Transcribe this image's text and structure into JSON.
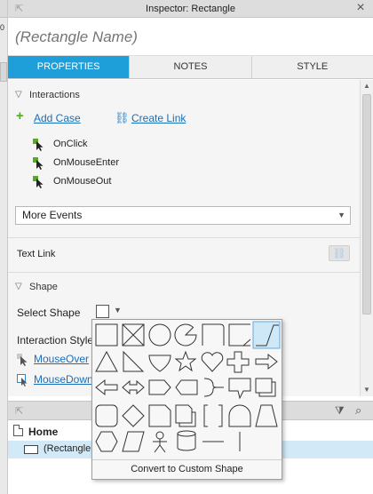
{
  "left_window": {
    "fragment_text": "0"
  },
  "titlebar": {
    "title": "Inspector: Rectangle"
  },
  "name_field": {
    "placeholder": "(Rectangle Name)",
    "value": ""
  },
  "tabs": [
    {
      "label": "PROPERTIES",
      "active": true
    },
    {
      "label": "NOTES",
      "active": false
    },
    {
      "label": "STYLE",
      "active": false
    }
  ],
  "interactions": {
    "heading": "Interactions",
    "add_case": "Add Case",
    "create_link": "Create Link",
    "events": [
      "OnClick",
      "OnMouseEnter",
      "OnMouseOut"
    ],
    "more_events": "More Events"
  },
  "text_link": {
    "label": "Text Link"
  },
  "shape": {
    "heading": "Shape",
    "select_shape_label": "Select Shape",
    "interaction_styles_label": "Interaction Style",
    "style_links": [
      "MouseOver",
      "MouseDown"
    ]
  },
  "shape_picker": {
    "convert_label": "Convert to Custom Shape",
    "shapes": [
      "rectangle",
      "placeholder",
      "ellipse",
      "pie",
      "corner-rectangle",
      "tab-rectangle",
      "snip-corner",
      "triangle",
      "right-triangle",
      "drop",
      "star",
      "heart",
      "plus",
      "right-arrow",
      "left-arrow",
      "double-arrow",
      "pentagon",
      "hexagon-tag",
      "brace",
      "callout",
      "stacked-pages",
      "rounded-rectangle",
      "diamond",
      "document",
      "multi-document",
      "bracket",
      "arch",
      "trapezoid",
      "hexagon",
      "parallelogram",
      "actor",
      "database",
      "horizontal-line",
      "vertical-line"
    ],
    "selected_index": 6
  },
  "outline": {
    "home_label": "Home",
    "selected_item": "(Rectangle"
  },
  "colors": {
    "tab_active": "#1e9fd9",
    "link": "#1a6fb8",
    "add_green": "#4caf1f",
    "selection": "#d2e9f7"
  }
}
